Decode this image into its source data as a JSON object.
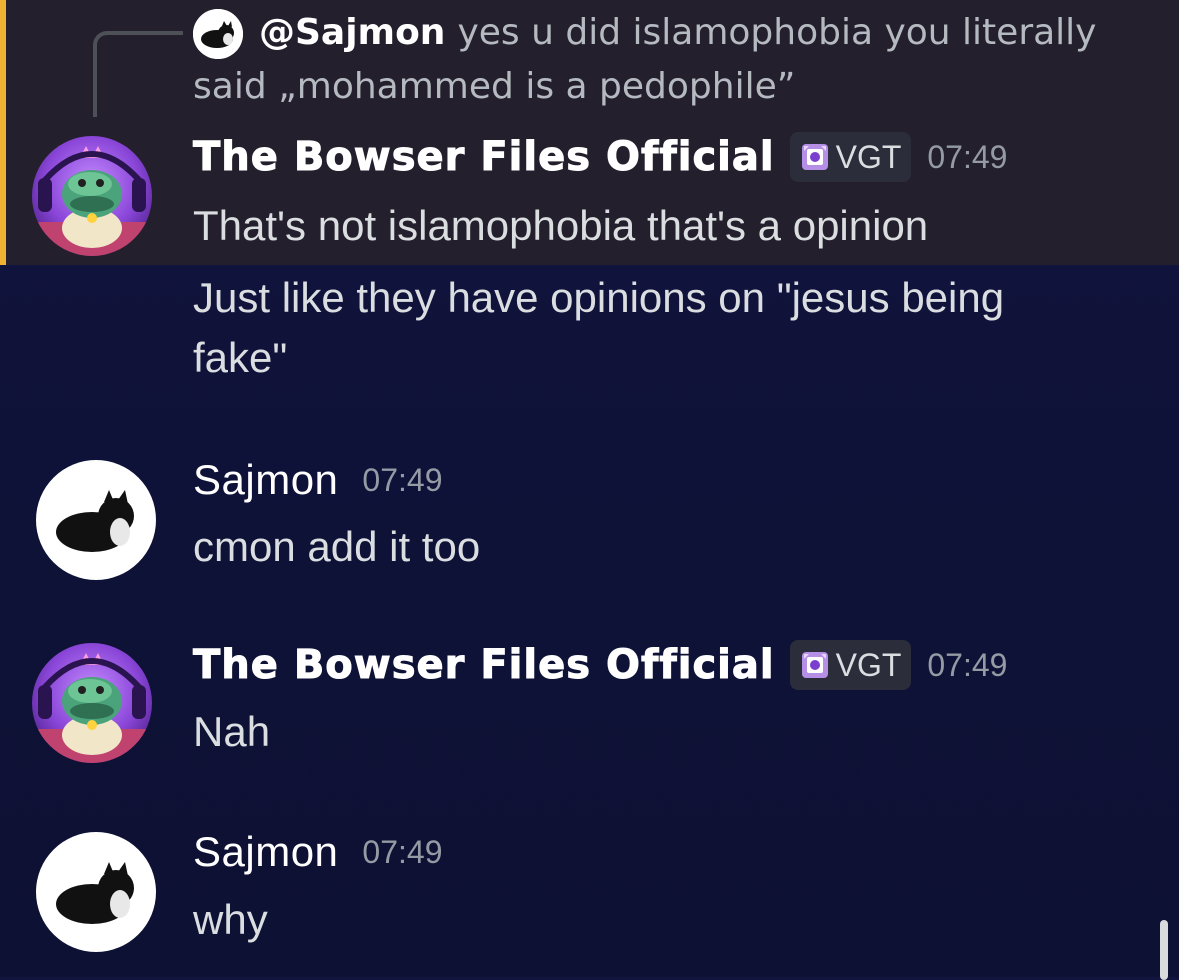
{
  "reply": {
    "author": "@Sajmon",
    "text_line1": "yes u did islamophobia you literally",
    "text_line2": "said „mohammed is a pedophile”"
  },
  "messages": [
    {
      "author": "The Bowser Files Official",
      "tag": "VGT",
      "time": "07:49",
      "lines": [
        "That's not islamophobia that's a opinion",
        "Just like they have opinions on \"jesus being",
        "fake\""
      ]
    },
    {
      "author": "Sajmon",
      "time": "07:49",
      "lines": [
        "cmon add it too"
      ]
    },
    {
      "author": "The Bowser Files Official",
      "tag": "VGT",
      "time": "07:49",
      "lines": [
        "Nah"
      ]
    },
    {
      "author": "Sajmon",
      "time": "07:49",
      "lines": [
        "why"
      ]
    }
  ],
  "colors": {
    "background": "#0f1238",
    "mention_highlight": "#241f2c",
    "mention_bar": "#f0b232",
    "tag_bg": "#2b2d3a",
    "timestamp": "#949ba4"
  },
  "icons": {
    "tag_icon": "guild-badge-icon",
    "bowser_avatar": "bowser-avatar-image",
    "sajmon_avatar": "cat-avatar-image"
  }
}
